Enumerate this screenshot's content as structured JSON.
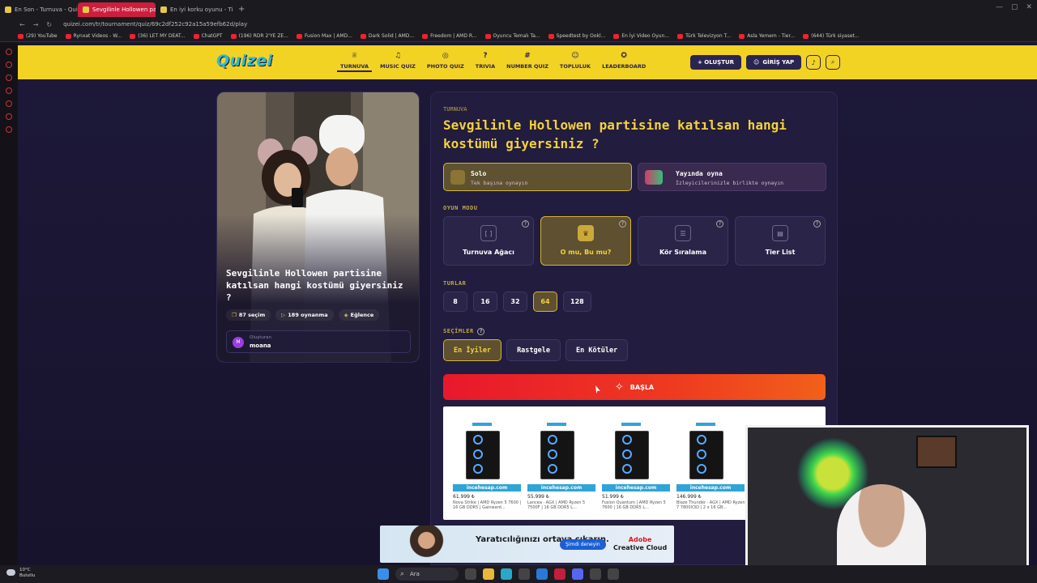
{
  "browser": {
    "tabs": [
      {
        "label": "En Son - Turnuva - Quizei",
        "active": false
      },
      {
        "label": "Sevgilinle Hollowen partis",
        "active": true
      },
      {
        "label": "En iyi korku oyunu - Tier l",
        "active": false
      }
    ],
    "url": "quizei.com/tr/tournament/quiz/69c2df252c92a15a59efb62d/play",
    "bookmarks": [
      "(29) YouTube",
      "Rynxat Videos - W...",
      "(36) LET MY DEAT...",
      "ChatGPT",
      "(196) RDR 2'YE ZE...",
      "Fusion Max | AMD...",
      "Dark Solid | AMD...",
      "Freedom | AMD R...",
      "Oyuncu Temalı Ta...",
      "Speedtest by Ookl...",
      "En İyi Video Oyun...",
      "Türk Televizyon T...",
      "Asla Yemem - Tier...",
      "(644) Türk siyaset..."
    ]
  },
  "header": {
    "logo": "Quizei",
    "nav": [
      {
        "label": "TURNUVA",
        "icon": "trophy-icon",
        "glyph": "♕",
        "active": true
      },
      {
        "label": "MUSIC QUIZ",
        "icon": "music-icon",
        "glyph": "♫"
      },
      {
        "label": "PHOTO QUIZ",
        "icon": "camera-icon",
        "glyph": "◎"
      },
      {
        "label": "TRIVIA",
        "icon": "question-icon",
        "glyph": "?"
      },
      {
        "label": "NUMBER QUIZ",
        "icon": "hash-icon",
        "glyph": "#"
      },
      {
        "label": "TOPLULUK",
        "icon": "users-icon",
        "glyph": "☺"
      },
      {
        "label": "LEADERBOARD",
        "icon": "medal-icon",
        "glyph": "✪"
      }
    ],
    "create_label": "+ OLUŞTUR",
    "login_label": "GİRİŞ YAP"
  },
  "card": {
    "title": "Sevgilinle Hollowen partisine katılsan hangi kostümü giyersiniz ?",
    "stats": [
      {
        "icon": "cards-icon",
        "glyph": "❐",
        "label": "87 seçim"
      },
      {
        "icon": "play-icon",
        "glyph": "▷",
        "label": "189 oynanma"
      },
      {
        "icon": "tag-icon",
        "glyph": "◈",
        "label": "Eğlence"
      }
    ],
    "creator_label": "Oluşturan",
    "creator_name": "moana",
    "creator_initial": "M"
  },
  "panel": {
    "kind": "TURNUVA",
    "title": "Sevgilinle Hollowen partisine katılsan hangi kostümü giyersiniz ?",
    "solo": {
      "title": "Solo",
      "subtitle": "Tek başına oynayın"
    },
    "stream": {
      "title": "Yayında oyna",
      "subtitle": "İzleyicilerinizle birlikte oynayın"
    },
    "game_mode_label": "OYUN MODU",
    "game_modes": [
      {
        "label": "Turnuva Ağacı",
        "glyph": "[ ]",
        "selected": false
      },
      {
        "label": "O mu, Bu mu?",
        "glyph": "♛",
        "selected": true
      },
      {
        "label": "Kör Sıralama",
        "glyph": "☰",
        "selected": false
      },
      {
        "label": "Tier List",
        "glyph": "▤",
        "selected": false
      }
    ],
    "rounds_label": "TURLAR",
    "rounds": [
      {
        "label": "8",
        "selected": false
      },
      {
        "label": "16",
        "selected": false
      },
      {
        "label": "32",
        "selected": false
      },
      {
        "label": "64",
        "selected": true
      },
      {
        "label": "128",
        "selected": false
      }
    ],
    "choices_label": "SEÇİMLER",
    "choices": [
      {
        "label": "En İyiler",
        "selected": true
      },
      {
        "label": "Rastgele",
        "selected": false
      },
      {
        "label": "En Kötüler",
        "selected": false
      }
    ],
    "start_label": "BAŞLA"
  },
  "ads": {
    "products": [
      {
        "brand": "incehesap.com",
        "price": "61.999 ₺",
        "desc": "Nova Strike | AMD Ryzen 5 7600 | 16 GB DDR5 | Gainward..."
      },
      {
        "brand": "incehesap.com",
        "price": "55.999 ₺",
        "desc": "Lancea · AGX | AMD Ryzen 5 7500F | 16 GB DDR5 L..."
      },
      {
        "brand": "incehesap.com",
        "price": "51.999 ₺",
        "desc": "Fusion Quantum | AMD Ryzen 5 7600 | 16 GB DDR5 L..."
      },
      {
        "brand": "incehesap.com",
        "price": "146.999 ₺",
        "desc": "Blaze Thunder · AGX | AMD Ryzen 7 7800X3D | 2 x 16 GB..."
      }
    ],
    "adobe_text": "Yaratıcılığınızı ortaya çıkarın.",
    "adobe_button": "Şimdi deneyin",
    "adobe_brand": "Adobe",
    "adobe_product": "Creative Cloud"
  },
  "taskbar": {
    "temperature": "10°C",
    "weather": "Bulutlu",
    "search": "Ara"
  },
  "colors": {
    "brand_yellow": "#f2d324",
    "start_red": "#e8182c",
    "selected_gold": "#d6b63a",
    "panel_bg": "#221c3e"
  }
}
